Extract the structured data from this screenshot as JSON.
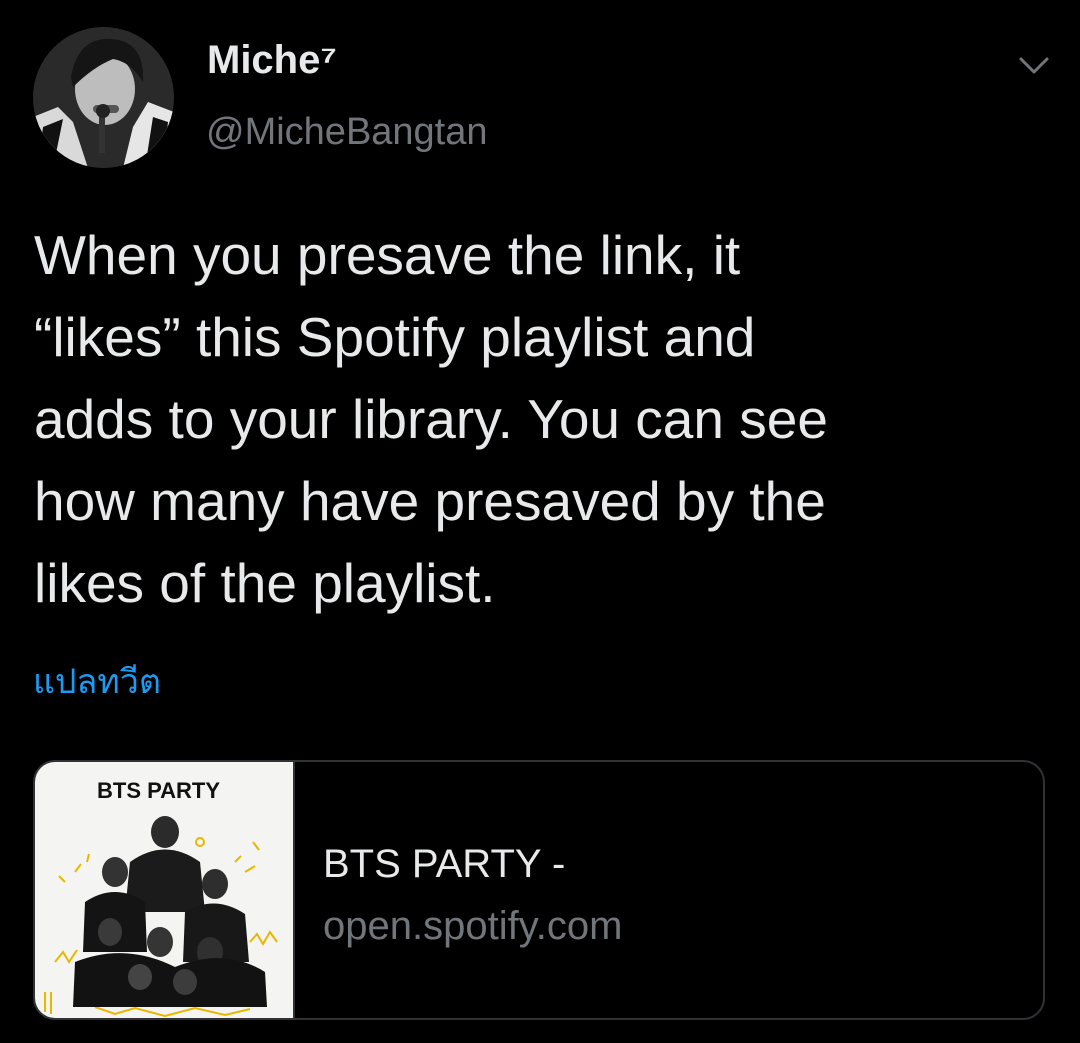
{
  "author": {
    "display_name": "Miche⁷",
    "handle": "@MicheBangtan",
    "avatar_icon": "avatar-photo"
  },
  "menu": {
    "icon": "chevron-down-icon"
  },
  "tweet": {
    "text": "When you presave the link, it\n“likes” this Spotify playlist and\nadds to your library. You can see\nhow many have presaved by the\nlikes of the playlist.",
    "translate_label": "แปลทวีต"
  },
  "link_card": {
    "thumbnail_title": "BTS PARTY",
    "title": "BTS PARTY -",
    "domain": "open.spotify.com"
  },
  "colors": {
    "background": "#000000",
    "text_primary": "#e7e9ea",
    "text_secondary": "#71767b",
    "link": "#1d9bf0",
    "border": "#2f3336"
  }
}
